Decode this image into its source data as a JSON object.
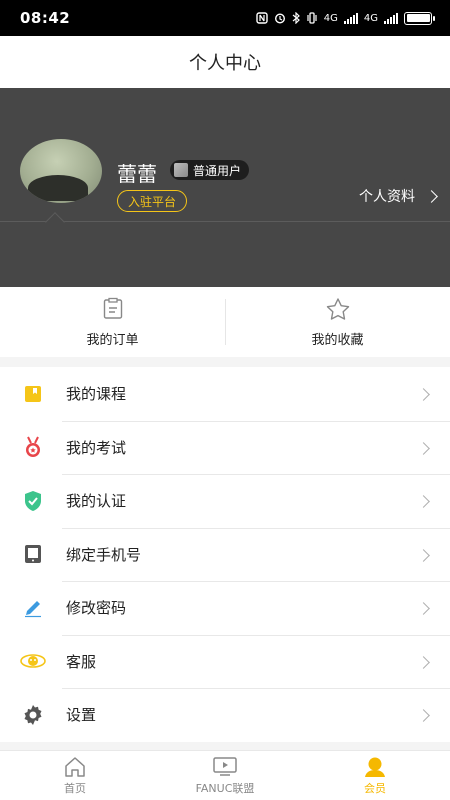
{
  "status_bar": {
    "time": "08:42",
    "network": "4G",
    "network2": "4G"
  },
  "header": {
    "title": "个人中心"
  },
  "profile": {
    "username": "蕾蕾",
    "level": "普通用户",
    "join_button": "入驻平台",
    "profile_link": "个人资料"
  },
  "shortcuts": [
    {
      "label": "我的订单",
      "icon": "order-icon"
    },
    {
      "label": "我的收藏",
      "icon": "star-icon"
    }
  ],
  "menu": [
    {
      "label": "我的课程",
      "icon": "course-icon",
      "color": "#f5c518"
    },
    {
      "label": "我的考试",
      "icon": "medal-icon",
      "color": "#e8454a"
    },
    {
      "label": "我的认证",
      "icon": "shield-check-icon",
      "color": "#3cc48c"
    },
    {
      "label": "绑定手机号",
      "icon": "tablet-icon",
      "color": "#555555"
    },
    {
      "label": "修改密码",
      "icon": "pencil-icon",
      "color": "#3d9be0"
    },
    {
      "label": "客服",
      "icon": "headset-icon",
      "color": "#f5c518"
    },
    {
      "label": "设置",
      "icon": "gear-icon",
      "color": "#555555"
    }
  ],
  "tabbar": [
    {
      "label": "首页",
      "icon": "home-icon",
      "active": false
    },
    {
      "label": "FANUC联盟",
      "icon": "tv-icon",
      "active": false
    },
    {
      "label": "会员",
      "icon": "member-icon",
      "active": true
    }
  ],
  "colors": {
    "accent": "#f5b800",
    "profile_bg": "#474747"
  }
}
